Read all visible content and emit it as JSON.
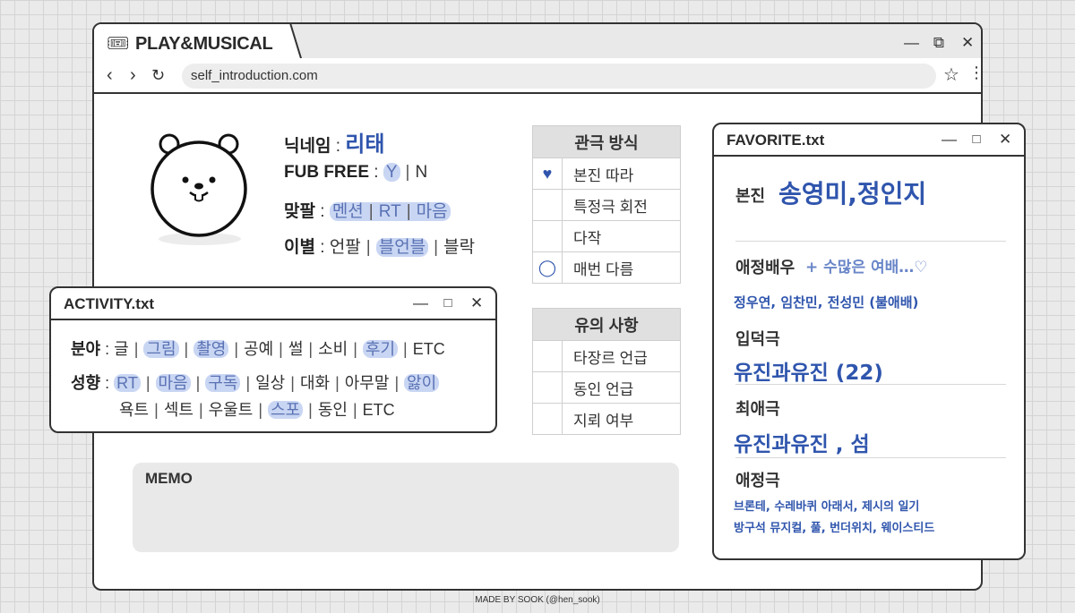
{
  "browser": {
    "tab_title": "PLAY&MUSICAL",
    "url": "self_introduction.com",
    "controls": {
      "minimize": "—",
      "restore": "⧉",
      "close": "✕"
    }
  },
  "icons": {
    "tab": "ticket-icon",
    "back": "chevron-left-icon",
    "forward": "chevron-right-icon",
    "reload": "reload-icon",
    "star": "star-icon",
    "menu": "kebab-menu-icon"
  },
  "colors": {
    "accent": "#2f55ad",
    "highlight": "#c9d6f3"
  },
  "profile": {
    "nickname_label": "닉네임",
    "nickname_value": "리태",
    "fubfree_label": "FUB FREE",
    "fubfree_y": "Y",
    "fubfree_n": "N",
    "follow_label": "맞팔",
    "follow_options": [
      "멘션",
      "RT",
      "마음"
    ],
    "parting_label": "이별",
    "parting_opt1": "언팔",
    "parting_opt2": "블언블",
    "parting_opt3": "블락"
  },
  "viewing": {
    "header": "관극 방식",
    "rows": [
      {
        "mark": "♥",
        "label": "본진 따라"
      },
      {
        "mark": "",
        "label": "특정극 회전"
      },
      {
        "mark": "",
        "label": "다작"
      },
      {
        "mark": "◯",
        "label": "매번 다름"
      }
    ]
  },
  "caution": {
    "header": "유의 사항",
    "rows": [
      "타장르 언급",
      "동인 언급",
      "지뢰 여부"
    ]
  },
  "memo": {
    "title": "MEMO"
  },
  "activity": {
    "title": "ACTIVITY.txt",
    "field_label": "분야",
    "field_items": [
      "글",
      "그림",
      "촬영",
      "공예",
      "썰",
      "소비",
      "후기",
      "ETC"
    ],
    "tendency_label": "성향",
    "tendency_items_1": [
      "RT",
      "마음",
      "구독",
      "일상",
      "대화",
      "아무말",
      "앓이"
    ],
    "tendency_items_2": [
      "욕트",
      "섹트",
      "우울트",
      "스포",
      "동인",
      "ETC"
    ]
  },
  "favorite": {
    "title": "FAVORITE.txt",
    "main_label": "본진",
    "main_value": "송영미,정인지",
    "fav_actor_label": "애정배우",
    "fav_actor_note": "+ 수많은 여배…♡",
    "fav_actor_list": "정우연, 임찬민, 전성민 (불애배)",
    "entry_label": "입덕극",
    "entry_value": "유진과유진 (22)",
    "best_label": "최애극",
    "best_value": "유진과유진 , 섬",
    "loved_label": "애정극",
    "loved_line1": "브론테, 수레바퀴 아래서, 제시의 일기",
    "loved_line2": "방구석 뮤지컬, 풀, 번더위치, 웨이스티드"
  },
  "credit": "MADE BY SOOK (@hen_sook)"
}
